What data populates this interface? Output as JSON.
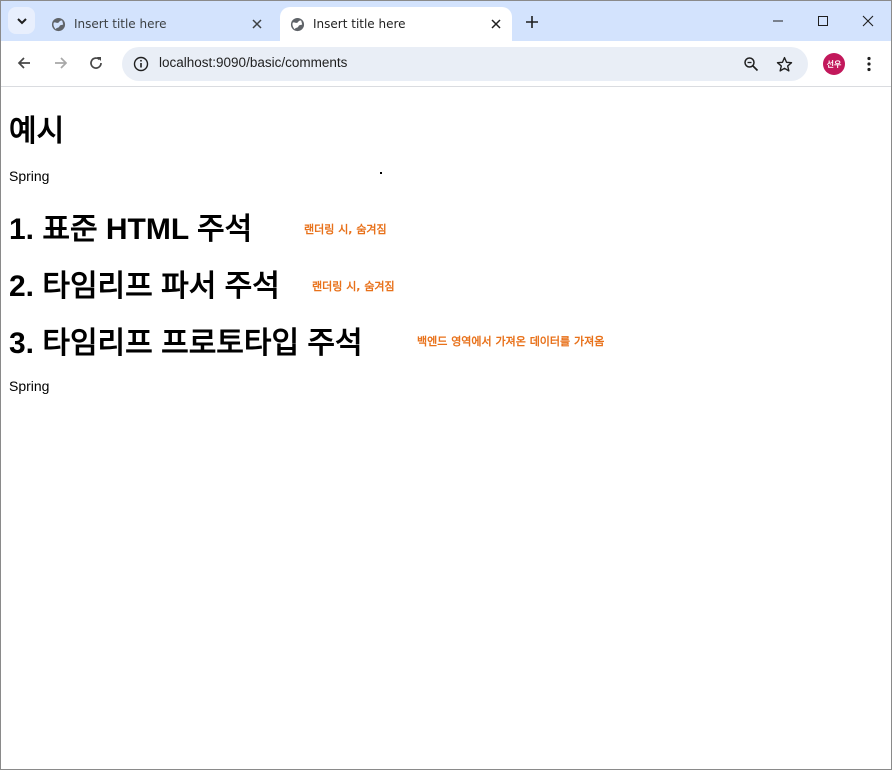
{
  "tabs": [
    {
      "title": "Insert title here",
      "active": false
    },
    {
      "title": "Insert title here",
      "active": true
    }
  ],
  "address_bar": {
    "url": "localhost:9090/basic/comments"
  },
  "profile": {
    "initials": "선우",
    "color": "#c2185b"
  },
  "page": {
    "title": "예시",
    "first_value": "Spring",
    "sections": [
      {
        "heading": "1. 표준 HTML 주석",
        "note": "랜더링 시, 숨겨짐"
      },
      {
        "heading": "2. 타임리프 파서 주석",
        "note": "랜더링 시, 숨겨짐"
      },
      {
        "heading": "3. 타임리프 프로토타입 주석",
        "note": "백엔드 영역에서 가져온 데이터를 가져옴"
      }
    ],
    "last_value": "Spring"
  },
  "colors": {
    "note": "#e8711a",
    "tabstrip": "#d3e3fd"
  },
  "icons": {
    "tab_search": "chevron-down-icon",
    "favicon": "globe-icon",
    "new_tab": "plus-icon",
    "site_info": "info-icon",
    "zoom": "zoom-icon",
    "bookmark": "star-icon",
    "menu": "kebab-menu-icon"
  }
}
